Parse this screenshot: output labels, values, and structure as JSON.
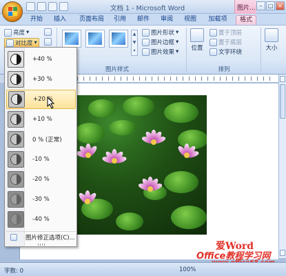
{
  "window": {
    "title": "文档 1 - Microsoft Word",
    "context_group": "图片..."
  },
  "tabs": [
    {
      "label": "开始"
    },
    {
      "label": "插入"
    },
    {
      "label": "页面布局"
    },
    {
      "label": "引用"
    },
    {
      "label": "邮件"
    },
    {
      "label": "审阅"
    },
    {
      "label": "视图"
    },
    {
      "label": "加载项"
    },
    {
      "label": "格式"
    }
  ],
  "ribbon": {
    "brightness_label": "亮度",
    "contrast_label": "对比度",
    "picture_shape_label": "图片形状",
    "picture_border_label": "图片边框",
    "picture_effects_label": "图片效果",
    "picture_styles_group": "图片样式",
    "bring_forward_label": "置于顶层",
    "send_backward_label": "置于底层",
    "text_wrap_label": "文字环绕",
    "position_label": "位置",
    "arrange_group": "排列",
    "size_label": "大小"
  },
  "contrast_menu": {
    "items": [
      {
        "label": "+40 %",
        "value": 40
      },
      {
        "label": "+30 %",
        "value": 30
      },
      {
        "label": "+20 %",
        "value": 20
      },
      {
        "label": "+10 %",
        "value": 10
      },
      {
        "label": "0 % (正常)",
        "value": 0
      },
      {
        "label": "-10 %",
        "value": -10
      },
      {
        "label": "-20 %",
        "value": -20
      },
      {
        "label": "-30 %",
        "value": -30
      },
      {
        "label": "-40 %",
        "value": -40
      }
    ],
    "highlighted_value": 20,
    "footer_label": "图片修正选项(C)..."
  },
  "statusbar": {
    "word_count": "字数: 0",
    "zoom": "100%"
  },
  "watermark": {
    "line1": "爱Word",
    "line2": "Office教程学习网",
    "line3": "www.office68.com"
  },
  "colors": {
    "accent_hover": "#fde29b",
    "context_tab": "#f4cfe0",
    "ribbon_bg": "#dce8f7"
  }
}
